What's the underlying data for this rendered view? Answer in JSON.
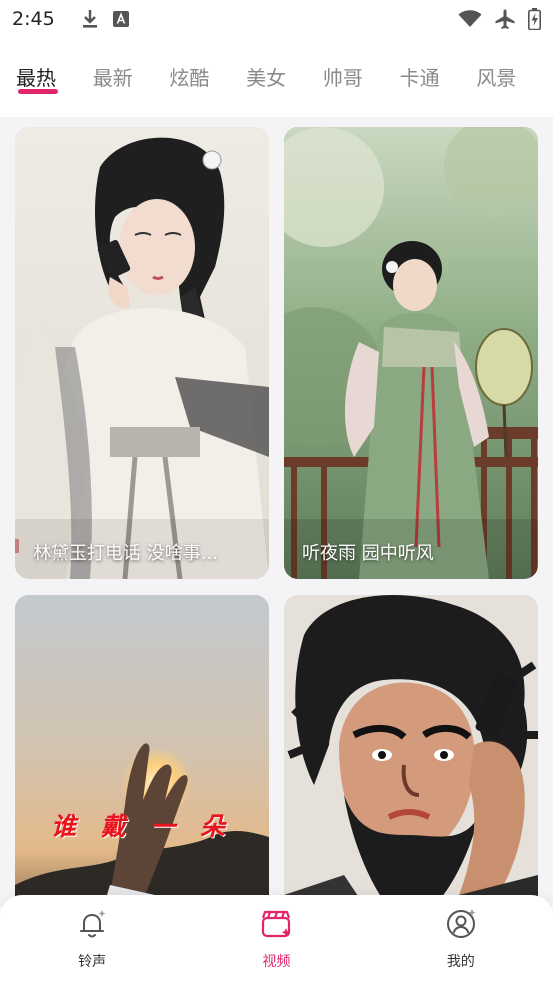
{
  "status_bar": {
    "time": "2:45",
    "icons": [
      "download-icon",
      "keyboard-a-icon",
      "wifi-icon",
      "airplane-mode-icon",
      "battery-charging-icon"
    ]
  },
  "tabs": [
    {
      "label": "最热",
      "active": true
    },
    {
      "label": "最新",
      "active": false
    },
    {
      "label": "炫酷",
      "active": false
    },
    {
      "label": "美女",
      "active": false
    },
    {
      "label": "帅哥",
      "active": false
    },
    {
      "label": "卡通",
      "active": false
    },
    {
      "label": "风景",
      "active": false
    }
  ],
  "feed": {
    "cards": [
      {
        "caption": "林黛玉打电话 没啥事..."
      },
      {
        "caption": "听夜雨 园中听风"
      },
      {
        "caption": "",
        "overlay_text": "谁 戴 一 朵"
      },
      {
        "caption": ""
      }
    ]
  },
  "bottom_nav": {
    "items": [
      {
        "label": "铃声",
        "icon": "bell-icon",
        "active": false
      },
      {
        "label": "视频",
        "icon": "video-clapper-icon",
        "active": true
      },
      {
        "label": "我的",
        "icon": "profile-icon",
        "active": false
      }
    ]
  },
  "colors": {
    "accent": "#e3256b",
    "tab_inactive": "#8a8a8a",
    "tab_active": "#222222",
    "feed_background": "#f4f4f6"
  }
}
